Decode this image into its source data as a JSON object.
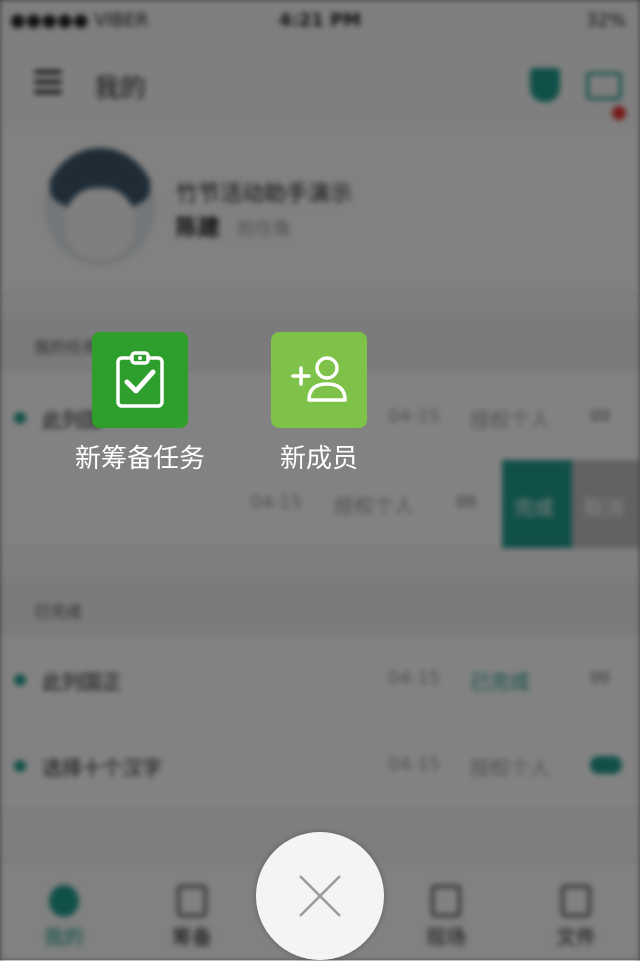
{
  "status_bar": {
    "signal": "●●●●● VIBER",
    "time": "4:21 PM",
    "battery": "32%"
  },
  "navbar": {
    "title": "我的"
  },
  "profile": {
    "line1": "竹节活动助手演示",
    "name": "陈建",
    "sub": "担任角"
  },
  "section1": {
    "header": "我的任务"
  },
  "section2": {
    "header": "已完成"
  },
  "rows": [
    {
      "name": "此列国",
      "date": "04-15",
      "who": "授权个人",
      "badge": "00"
    },
    {
      "name": "",
      "date": "04-15",
      "who": "授权个人",
      "badge": "00",
      "finish": "完成",
      "cancel": "取消"
    },
    {
      "name": "此列国正",
      "date": "04-15",
      "status": "已完成",
      "badge": "00"
    },
    {
      "name": "选择十个汉字",
      "date": "04-15",
      "who": "授权个人"
    }
  ],
  "tabbar": {
    "tabs": [
      "我的",
      "筹备",
      "",
      "现场",
      "文件"
    ]
  },
  "overlay": {
    "actions": [
      {
        "label": "新筹备任务",
        "icon": "clipboard-check-icon",
        "color": "#2e9e2c"
      },
      {
        "label": "新成员",
        "icon": "add-person-icon",
        "color": "#7ec24a"
      }
    ],
    "close_icon": "close-icon"
  }
}
